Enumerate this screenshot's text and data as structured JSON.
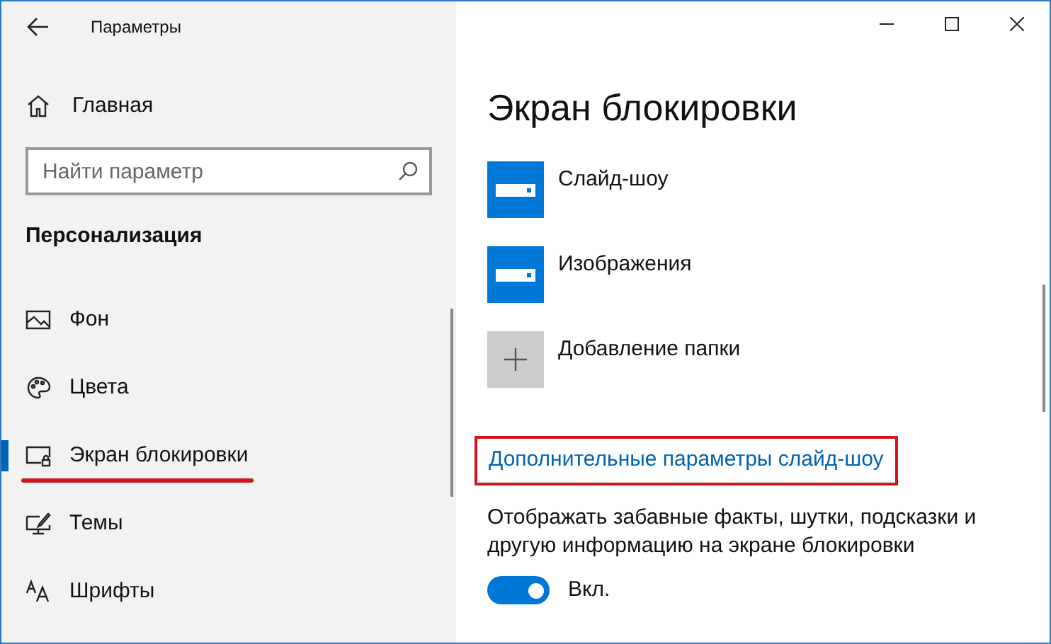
{
  "window": {
    "title": "Параметры"
  },
  "sidebar": {
    "home": "Главная",
    "search": {
      "placeholder": "Найти параметр"
    },
    "section": "Персонализация",
    "items": [
      {
        "label": "Фон",
        "selected": false
      },
      {
        "label": "Цвета",
        "selected": false
      },
      {
        "label": "Экран блокировки",
        "selected": true
      },
      {
        "label": "Темы",
        "selected": false
      },
      {
        "label": "Шрифты",
        "selected": false
      }
    ]
  },
  "page": {
    "title": "Экран блокировки",
    "folders": [
      {
        "kind": "folder",
        "label": "Слайд-шоу"
      },
      {
        "kind": "folder",
        "label": "Изображения"
      },
      {
        "kind": "add",
        "label": "Добавление папки"
      }
    ],
    "link": "Дополнительные параметры слайд-шоу",
    "description": "Отображать забавные факты, шутки, подсказки и другую информацию на экране блокировки",
    "toggle": {
      "on": true,
      "label": "Вкл."
    }
  }
}
